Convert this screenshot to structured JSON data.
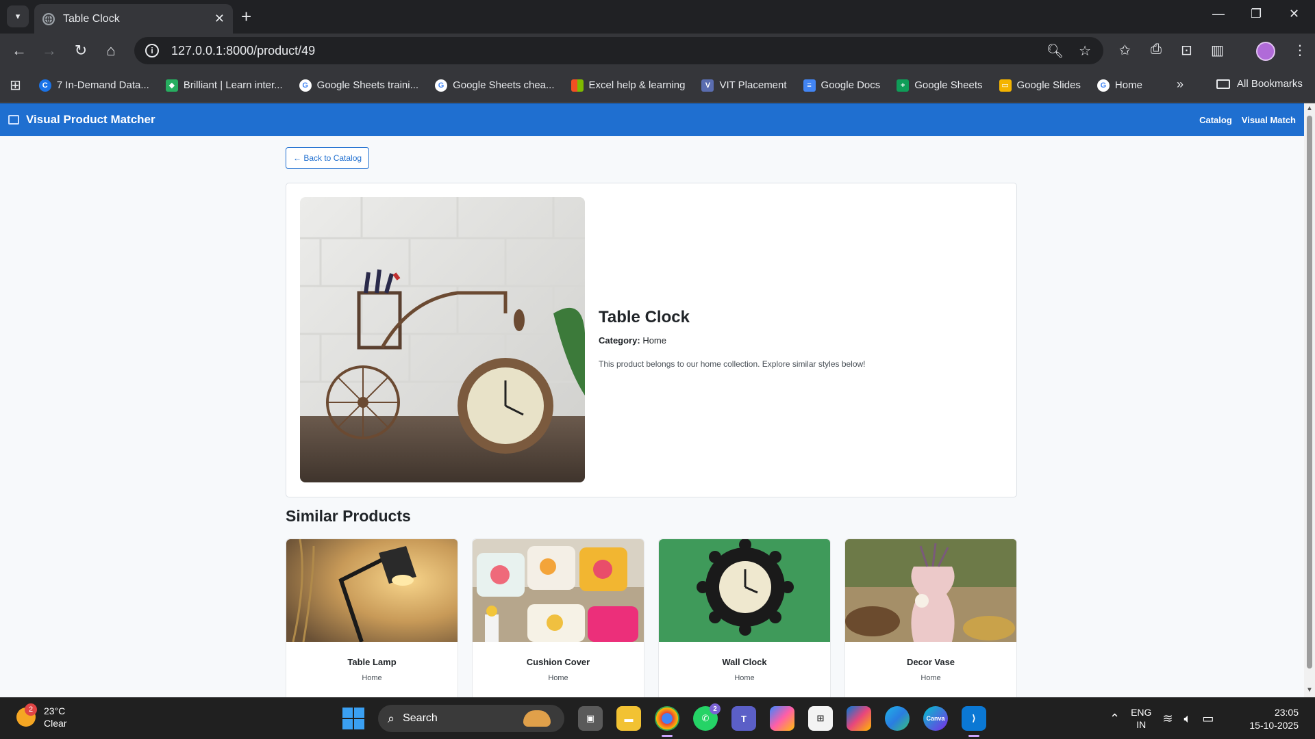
{
  "browser": {
    "tab_title": "Table Clock",
    "url": "127.0.0.1:8000/product/49",
    "bookmarks": [
      {
        "label": "7 In-Demand Data...",
        "icon": "coursera-icon",
        "color": "#1a73e8"
      },
      {
        "label": "Brilliant | Learn inter...",
        "icon": "brilliant-icon",
        "color": "#27ae60"
      },
      {
        "label": "Google Sheets traini...",
        "icon": "google-icon",
        "color": "#ffffff"
      },
      {
        "label": "Google Sheets chea...",
        "icon": "google-icon",
        "color": "#ffffff"
      },
      {
        "label": "Excel help & learning",
        "icon": "microsoft-icon",
        "color": "#f25022"
      },
      {
        "label": "VIT Placement",
        "icon": "vit-icon",
        "color": "#5a6db0"
      },
      {
        "label": "Google Docs",
        "icon": "docs-icon",
        "color": "#4285f4"
      },
      {
        "label": "Google Sheets",
        "icon": "sheets-icon",
        "color": "#0f9d58"
      },
      {
        "label": "Google Slides",
        "icon": "slides-icon",
        "color": "#f4b400"
      },
      {
        "label": "Home",
        "icon": "google-icon",
        "color": "#ffffff"
      }
    ],
    "all_bookmarks": "All Bookmarks"
  },
  "app": {
    "brand": "Visual Product Matcher",
    "nav": [
      "Catalog",
      "Visual Match"
    ],
    "accent": "#1f6fd0"
  },
  "product": {
    "back_label": "← Back to Catalog",
    "title": "Table Clock",
    "category_label": "Category:",
    "category": "Home",
    "description": "This product belongs to our home collection. Explore similar styles below!"
  },
  "similar": {
    "heading": "Similar Products",
    "items": [
      {
        "name": "Table Lamp",
        "category": "Home"
      },
      {
        "name": "Cushion Cover",
        "category": "Home"
      },
      {
        "name": "Wall Clock",
        "category": "Home"
      },
      {
        "name": "Decor Vase",
        "category": "Home"
      }
    ]
  },
  "taskbar": {
    "weather_temp": "23°C",
    "weather_cond": "Clear",
    "weather_badge": "2",
    "search_label": "Search",
    "whatsapp_badge": "2",
    "lang_1": "ENG",
    "lang_2": "IN",
    "time": "23:05",
    "date": "15-10-2025"
  }
}
